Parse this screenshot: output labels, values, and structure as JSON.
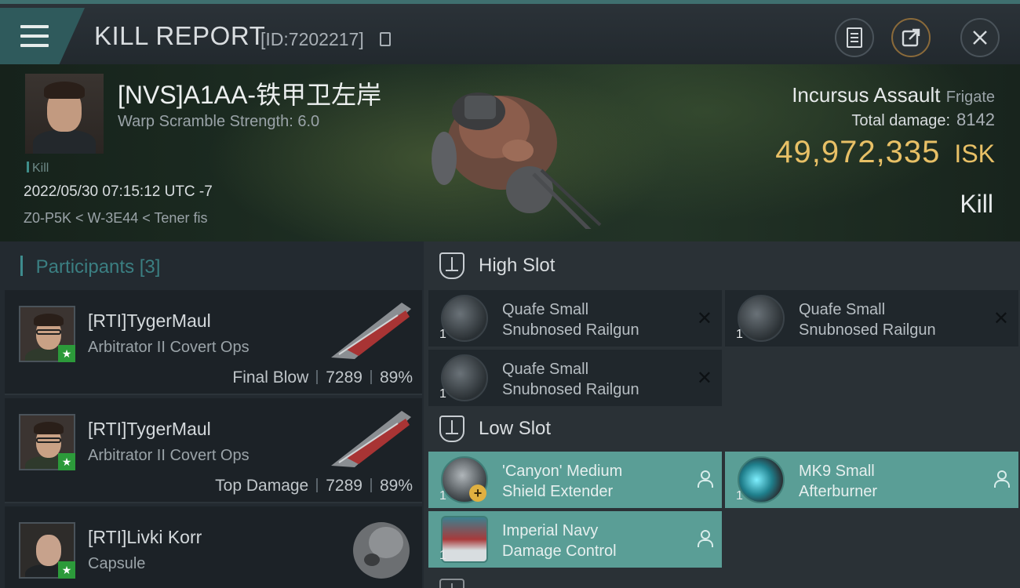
{
  "header": {
    "title": "KILL REPORT",
    "report_id": "[ID:7202217]"
  },
  "victim": {
    "name": "[NVS]A1AA-铁甲卫左岸",
    "warp_scramble": "Warp Scramble Strength: 6.0",
    "tag": "Kill",
    "datetime": "2022/05/30 07:15:12 UTC -7",
    "location": "Z0-P5K < W-3E44 < Tener fis",
    "ship_name": "Incursus Assault",
    "ship_class": "Frigate",
    "total_damage_label": "Total damage:",
    "total_damage": "8142",
    "isk_value": "49,972,335",
    "isk_unit": "ISK",
    "result": "Kill"
  },
  "participants": {
    "label": "Participants",
    "count": "[3]",
    "items": [
      {
        "name": "[RTI]TygerMaul",
        "ship": "Arbitrator II Covert Ops",
        "role": "Final Blow",
        "damage": "7289",
        "percent": "89%"
      },
      {
        "name": "[RTI]TygerMaul",
        "ship": "Arbitrator II Covert Ops",
        "role": "Top Damage",
        "damage": "7289",
        "percent": "89%"
      },
      {
        "name": "[RTI]Livki Korr",
        "ship": "Capsule",
        "role": "",
        "damage": "",
        "percent": ""
      }
    ]
  },
  "fitting": {
    "high_slot_label": "High Slot",
    "low_slot_label": "Low Slot",
    "high": [
      {
        "qty": "1",
        "line1": "Quafe Small",
        "line2": "Snubnosed Railgun"
      },
      {
        "qty": "1",
        "line1": "Quafe Small",
        "line2": "Snubnosed Railgun"
      },
      {
        "qty": "1",
        "line1": "Quafe Small",
        "line2": "Snubnosed Railgun"
      }
    ],
    "low": [
      {
        "qty": "1",
        "line1": "'Canyon' Medium",
        "line2": "Shield Extender"
      },
      {
        "qty": "1",
        "line1": "MK9 Small",
        "line2": "Afterburner"
      },
      {
        "qty": "1",
        "line1": "Imperial Navy",
        "line2": "Damage Control"
      }
    ]
  },
  "colors": {
    "accent": "#3e8c8e",
    "isk": "#e8c066",
    "dropped": "#5a9e96",
    "star_badge": "#2c9a3a"
  }
}
